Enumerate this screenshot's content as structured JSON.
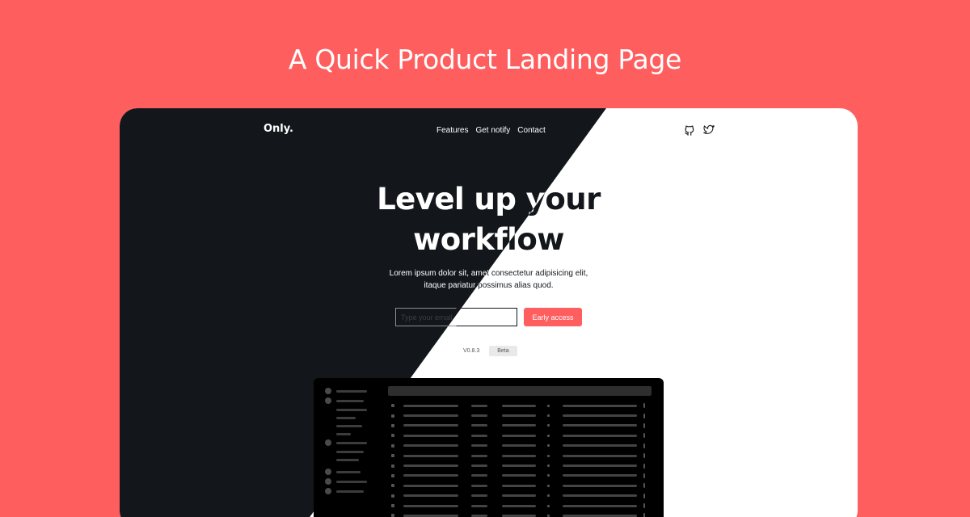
{
  "banner": {
    "title": "A Quick Product Landing Page"
  },
  "nav": {
    "logo": "Only.",
    "links": [
      "Features",
      "Get notify",
      "Contact"
    ],
    "icons": [
      "github-icon",
      "twitter-icon"
    ]
  },
  "hero": {
    "title_line1": "Level up your",
    "title_line2": "workflow",
    "subtitle_line1": "Lorem ipsum dolor sit, amet consectetur adipisicing elit,",
    "subtitle_line2": "itaque pariatur possimus alias quod."
  },
  "cta": {
    "input_placeholder": "Type your email",
    "button_label": "Early access"
  },
  "release": {
    "version": "V0.8.3",
    "badge": "Beta"
  },
  "colors": {
    "accent": "#ff5e5e",
    "dark": "#13171c",
    "light": "#ffffff"
  }
}
